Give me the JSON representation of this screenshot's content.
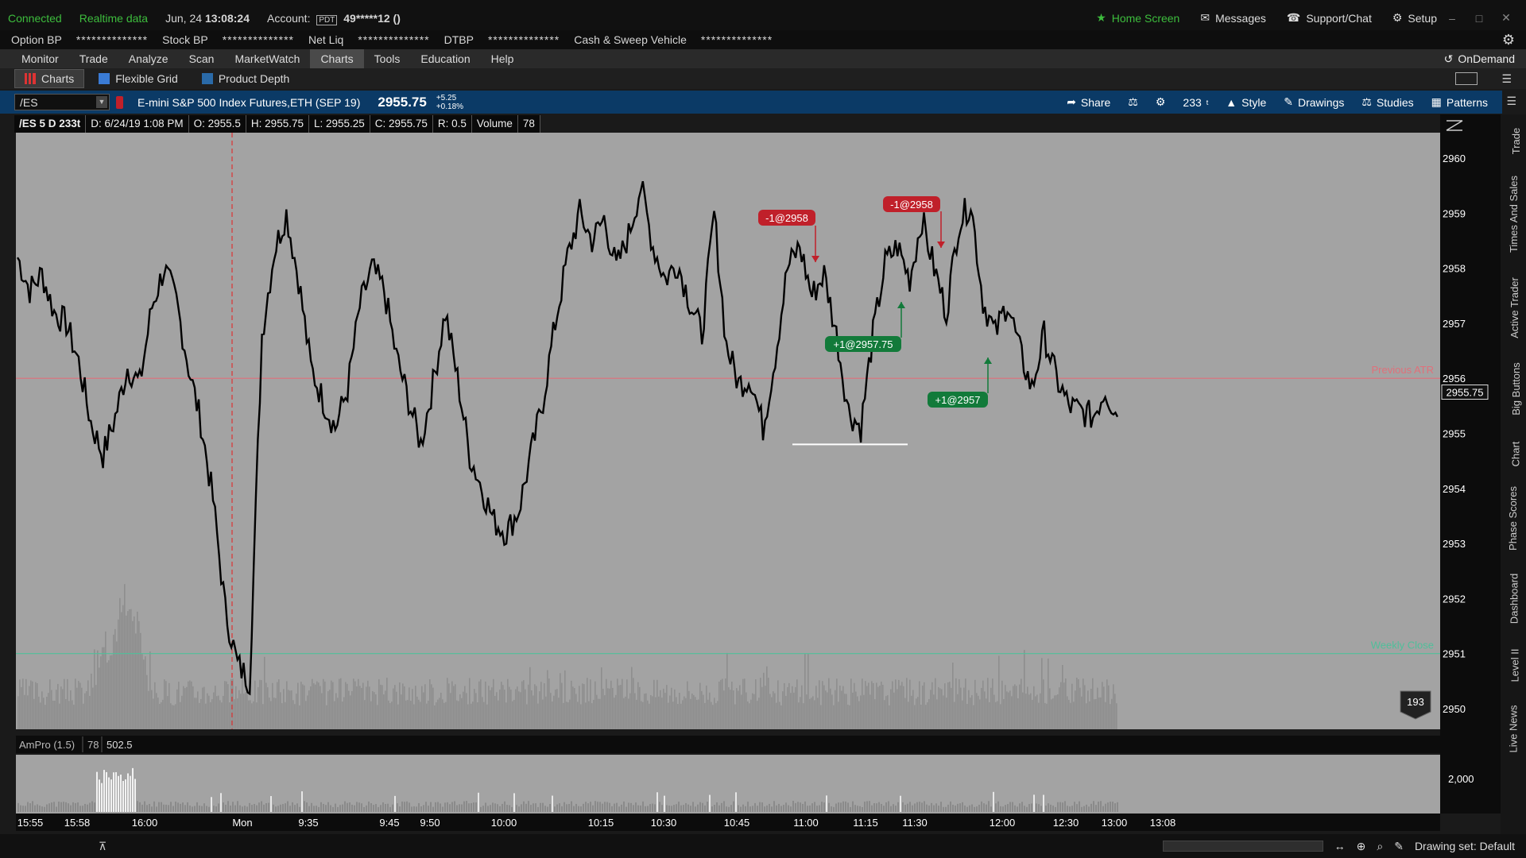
{
  "status_bar": {
    "connected": "Connected",
    "realtime": "Realtime data",
    "date": "Jun, 24",
    "time": "13:08:24",
    "account_label": "Account:",
    "account_badge": "PDT",
    "account_number": "49*****12 ()",
    "home_screen": "Home Screen",
    "messages": "Messages",
    "support": "Support/Chat",
    "setup": "Setup"
  },
  "balances": [
    {
      "label": "Option BP",
      "value": "**************"
    },
    {
      "label": "Stock BP",
      "value": "**************"
    },
    {
      "label": "Net Liq",
      "value": "**************"
    },
    {
      "label": "DTBP",
      "value": "**************"
    },
    {
      "label": "Cash & Sweep Vehicle",
      "value": "**************"
    }
  ],
  "nav": {
    "items": [
      "Monitor",
      "Trade",
      "Analyze",
      "Scan",
      "MarketWatch",
      "Charts",
      "Tools",
      "Education",
      "Help"
    ],
    "active": "Charts",
    "ondemand": "OnDemand"
  },
  "subnav": {
    "items": [
      "Charts",
      "Flexible Grid",
      "Product Depth"
    ]
  },
  "symbol_bar": {
    "symbol": "/ES",
    "description": "E-mini S&P 500 Index Futures,ETH (SEP 19)",
    "last": "2955.75",
    "change": "+5.25",
    "change_pct": "+0.18%",
    "share": "Share",
    "ticks": "233",
    "style": "Style",
    "drawings": "Drawings",
    "studies": "Studies",
    "patterns": "Patterns"
  },
  "info_bar": {
    "title": "/ES 5 D 233t",
    "date": "D: 6/24/19 1:08 PM",
    "open": "O: 2955.5",
    "high": "H: 2955.75",
    "low": "L: 2955.25",
    "close": "C: 2955.75",
    "range": "R: 0.5",
    "volume_label": "Volume",
    "volume": "78"
  },
  "chart_data": {
    "type": "line",
    "symbol": "/ES",
    "y_ticks": [
      2950,
      2951,
      2952,
      2953,
      2954,
      2955,
      2956,
      2957,
      2958,
      2959,
      2960
    ],
    "ylim": [
      2949.6,
      2960.4
    ],
    "x_tick_labels": [
      "15:55",
      "15:58",
      "16:00",
      "Mon",
      "9:35",
      "9:45",
      "9:50",
      "10:00",
      "10:15",
      "10:30",
      "10:45",
      "11:00",
      "11:15",
      "11:30",
      "12:00",
      "12:30",
      "13:00",
      "13:08"
    ],
    "price_path": [
      2958.2,
      2957.6,
      2957.9,
      2957.2,
      2957.0,
      2956.3,
      2955.2,
      2954.6,
      2955.3,
      2956.2,
      2955.9,
      2957.3,
      2958.0,
      2957.4,
      2956.2,
      2955.2,
      2953.8,
      2951.8,
      2950.8,
      2950.5,
      2956.8,
      2958.3,
      2959.0,
      2957.8,
      2956.2,
      2955.6,
      2955.1,
      2955.8,
      2957.3,
      2958.0,
      2957.6,
      2956.4,
      2955.6,
      2954.8,
      2955.9,
      2957.2,
      2956.0,
      2954.6,
      2954.0,
      2953.4,
      2953.2,
      2953.6,
      2954.6,
      2955.6,
      2957.0,
      2958.2,
      2959.0,
      2958.5,
      2958.9,
      2958.0,
      2958.6,
      2959.5,
      2958.4,
      2957.8,
      2958.1,
      2957.4,
      2956.8,
      2959.0,
      2956.6,
      2955.9,
      2956.0,
      2955.1,
      2956.4,
      2958.0,
      2958.4,
      2957.5,
      2957.9,
      2956.8,
      2955.4,
      2955.1,
      2956.8,
      2958.1,
      2958.4,
      2957.8,
      2958.9,
      2958.0,
      2957.2,
      2958.8,
      2959.2,
      2957.4,
      2956.8,
      2957.4,
      2956.5,
      2955.8,
      2956.8,
      2956.0,
      2955.5,
      2955.4,
      2955.3,
      2955.8,
      2955.3
    ],
    "horizontal_lines": [
      {
        "label": "Previous ATR",
        "value": 2956.0,
        "color": "#e0707a"
      },
      {
        "label": "Weekly Close",
        "value": 2951.0,
        "color": "#4fbf9a"
      }
    ],
    "level_line": {
      "value": 2954.8,
      "x_from": "11:05",
      "x_to": "11:25"
    },
    "current_price": "2955.75",
    "trades": [
      {
        "label": "-1@2958",
        "side": "sell",
        "price": 2958
      },
      {
        "label": "-1@2958",
        "side": "sell",
        "price": 2958
      },
      {
        "label": "+1@2957.75",
        "side": "buy",
        "price": 2957.75
      },
      {
        "label": "+1@2957",
        "side": "buy",
        "price": 2957
      }
    ],
    "session_marker": "Mon",
    "bubble_value": "193",
    "lower_study": {
      "name": "AmPro (1.5)",
      "value1": "78",
      "value2": "502.5",
      "y_tick": "2,000"
    }
  },
  "side_tabs": [
    "Trade",
    "Times And Sales",
    "Active Trader",
    "Big Buttons",
    "Chart",
    "Phase Scores",
    "Dashboard",
    "Level II",
    "Live News"
  ],
  "bottom_bar": {
    "drawing_set": "Drawing set: Default"
  },
  "colors": {
    "chart_bg": "#a3a3a3",
    "price_line": "#000000",
    "sell_marker": "#c0202a",
    "buy_marker": "#127a3a",
    "symbol_bar": "#0b3a66"
  }
}
